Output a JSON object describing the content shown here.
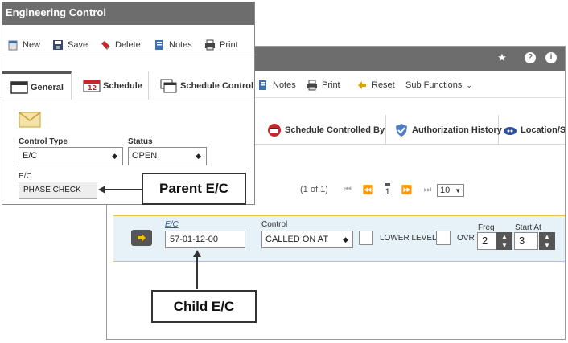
{
  "child": {
    "toolbar": {
      "notes": "Notes",
      "print": "Print",
      "reset": "Reset",
      "sub_functions": "Sub Functions"
    },
    "tabs": [
      {
        "label": "Schedule Controlled By",
        "icon": "schedule-controlled-icon"
      },
      {
        "label": "Authorization History",
        "icon": "shield-check-icon"
      },
      {
        "label": "Location/Sit",
        "icon": "location-icon"
      }
    ],
    "pager": {
      "range": "(1 of 1)",
      "page": "1",
      "page_size": "10"
    },
    "row": {
      "ec_label": "E/C",
      "ec_value": "57-01-12-00",
      "control_label": "Control",
      "control_value": "CALLED ON AT",
      "lower_level_label": "LOWER LEVEL",
      "ovr_label": "OVR",
      "freq_label": "Freq",
      "freq_value": "2",
      "start_at_label": "Start At",
      "start_at_value": "3"
    }
  },
  "parent": {
    "title": "Engineering Control",
    "toolbar": {
      "new": "New",
      "save": "Save",
      "delete": "Delete",
      "notes": "Notes",
      "print": "Print"
    },
    "tabs": [
      {
        "label": "General",
        "icon": "general-icon"
      },
      {
        "label": "Schedule",
        "icon": "calendar-icon"
      },
      {
        "label": "Schedule Control",
        "icon": "schedule-control-icon"
      }
    ],
    "form": {
      "control_type_label": "Control Type",
      "control_type_value": "E/C",
      "status_label": "Status",
      "status_value": "OPEN",
      "ec_label": "E/C",
      "ec_value": "PHASE CHECK"
    }
  },
  "callouts": {
    "parent": "Parent E/C",
    "child": "Child E/C"
  }
}
